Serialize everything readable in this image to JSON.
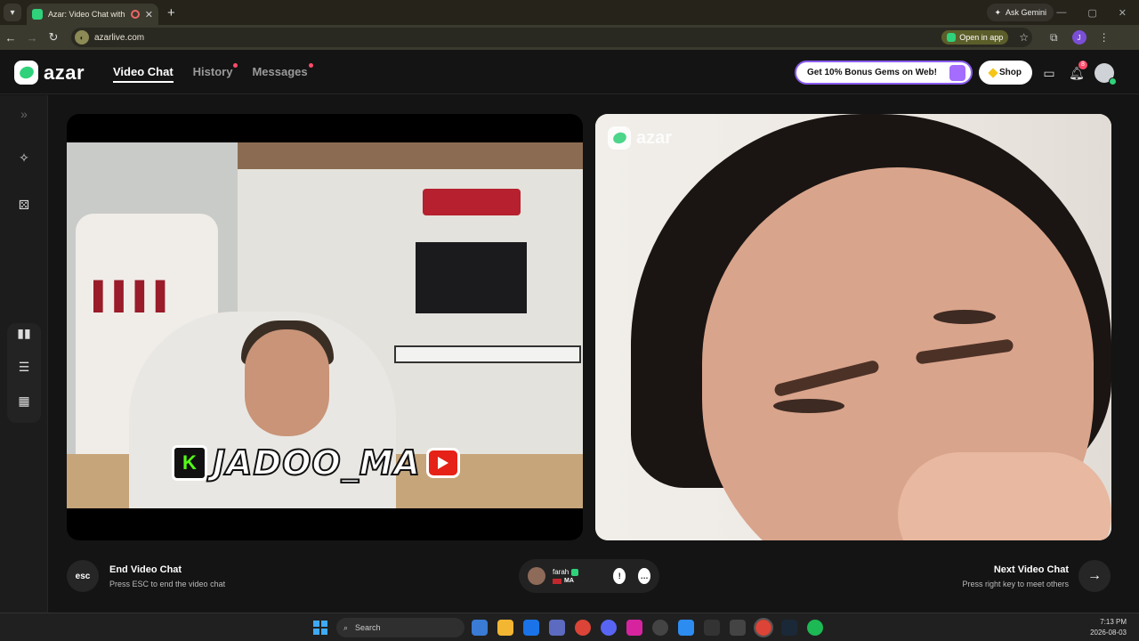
{
  "browser": {
    "tab_title": "Azar: Video Chat with New",
    "url": "azarlive.com",
    "ask_gemini": "Ask Gemini",
    "open_in_app": "Open in app",
    "profile_initial": "J"
  },
  "header": {
    "logo_text": "azar",
    "nav": [
      {
        "label": "Video Chat",
        "active": true
      },
      {
        "label": "History",
        "dot": true
      },
      {
        "label": "Messages",
        "dot": true
      }
    ],
    "promo": "Get 10% Bonus Gems on Web!",
    "shop": "Shop",
    "notification_count": "8"
  },
  "video": {
    "left_watermark": "JADOO_MA",
    "right_watermark": "azar"
  },
  "controls": {
    "esc_label": "esc",
    "end_title": "End Video Chat",
    "end_sub": "Press ESC to end the video chat",
    "partner_name": "farah",
    "partner_country": "MA",
    "next_title": "Next Video Chat",
    "next_sub": "Press right key to meet others"
  },
  "taskbar": {
    "search_placeholder": "Search",
    "time": "7:13 PM",
    "date": "2026-08-03"
  },
  "colors": {
    "accent_green": "#2fd27a",
    "notification_red": "#ff4b6b",
    "promo_border": "#8a5cf0"
  }
}
